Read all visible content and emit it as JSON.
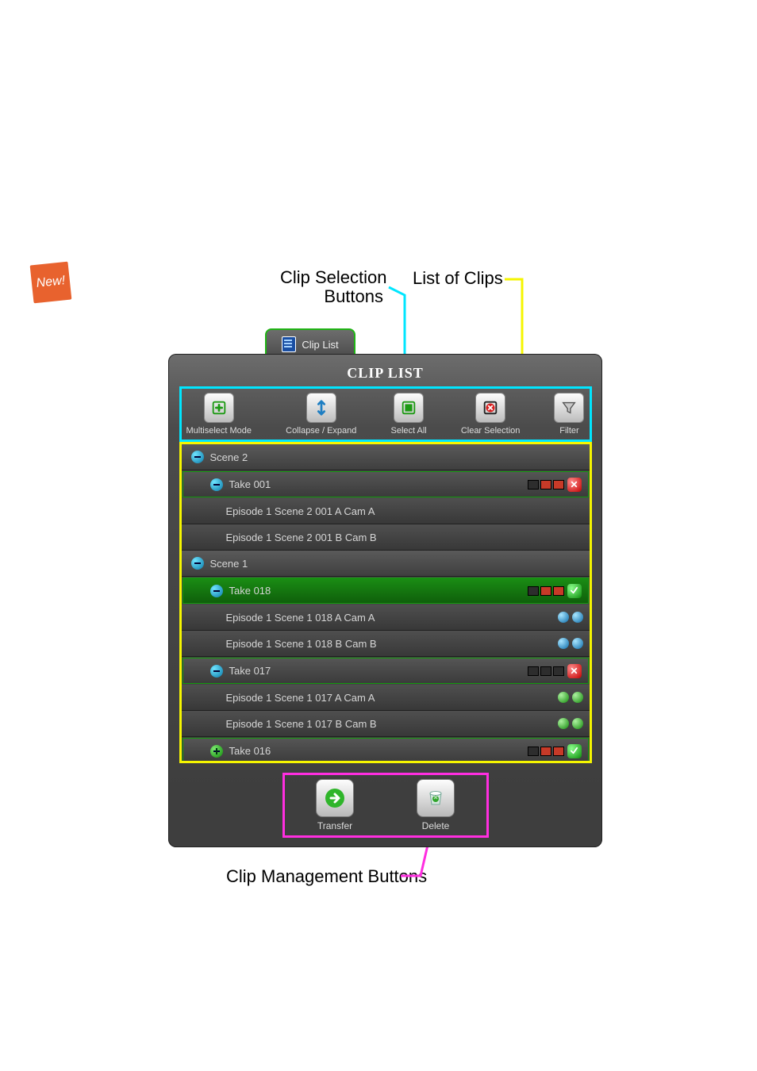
{
  "badge_new": "New!",
  "annotations": {
    "clip_selection": "Clip Selection\nButtons",
    "list_of_clips": "List of Clips",
    "clip_management": "Clip Management Buttons"
  },
  "tab": {
    "label": "Clip List"
  },
  "panel": {
    "title": "CLIP LIST"
  },
  "selection_buttons": {
    "multiselect": "Multiselect Mode",
    "collapse_expand": "Collapse / Expand",
    "select_all": "Select All",
    "clear_selection": "Clear Selection",
    "filter": "Filter"
  },
  "tree": [
    {
      "type": "scene",
      "toggle": "minus",
      "label": "Scene 2"
    },
    {
      "type": "take",
      "toggle": "minus",
      "label": "Take 001",
      "boxes": "sel",
      "badge": "red"
    },
    {
      "type": "clip",
      "label": "Episode 1 Scene 2 001 A Cam A"
    },
    {
      "type": "clip",
      "label": "Episode 1 Scene 2 001 B Cam B"
    },
    {
      "type": "scene",
      "toggle": "minus",
      "label": "Scene 1"
    },
    {
      "type": "take",
      "toggle": "minus",
      "label": "Take 018",
      "selected": true,
      "boxes": "sel",
      "badge": "green"
    },
    {
      "type": "clip",
      "label": "Episode 1 Scene 1 018 A Cam A",
      "dots": [
        "blue",
        "blue"
      ]
    },
    {
      "type": "clip",
      "label": "Episode 1 Scene 1 018 B Cam B",
      "dots": [
        "blue",
        "blue"
      ]
    },
    {
      "type": "take",
      "toggle": "minus",
      "label": "Take 017",
      "boxes": "dark",
      "badge": "red"
    },
    {
      "type": "clip",
      "label": "Episode 1 Scene 1 017 A Cam A",
      "dots": [
        "green",
        "green"
      ]
    },
    {
      "type": "clip",
      "label": "Episode 1 Scene 1 017 B Cam B",
      "dots": [
        "green",
        "green"
      ]
    },
    {
      "type": "take",
      "toggle": "plus",
      "label": "Take 016",
      "boxes": "sel",
      "badge": "green"
    }
  ],
  "management_buttons": {
    "transfer": "Transfer",
    "delete": "Delete"
  }
}
